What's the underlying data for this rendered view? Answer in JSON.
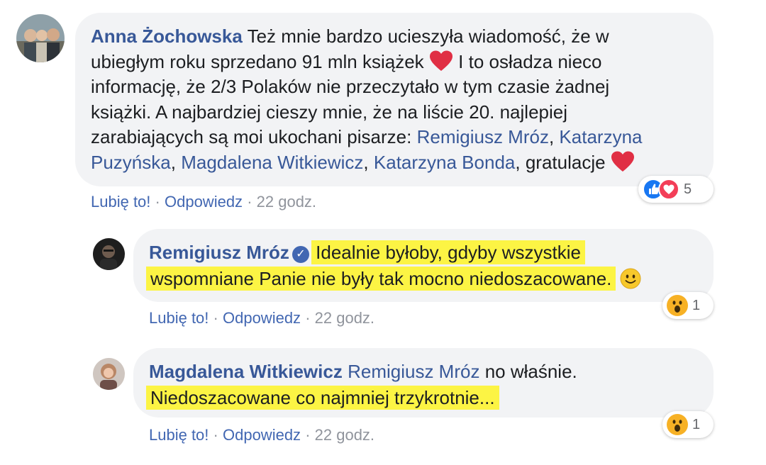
{
  "comment1": {
    "author": "Anna Żochowska",
    "text": {
      "l1": "Też mnie bardzo ucieszyła wiadomość, że w",
      "l2": "ubiegłym roku sprzedano 91 mln książek",
      "l2b": "I to osładza nieco",
      "l3": "informację, że 2/3 Polaków nie przeczytało w tym czasie żadnej",
      "l4": "książki. A najbardziej cieszy mnie, że na liście 20. najlepiej",
      "l5": "zarabiających są moi ukochani pisarze:",
      "mentions": [
        "Remigiusz Mróz",
        "Katarzyna",
        "Puzyńska",
        "Magdalena Witkiewicz",
        "Katarzyna Bonda"
      ],
      "sep": ",",
      "end": "gratulacje"
    },
    "reaction_count": "5",
    "reactions": [
      "like",
      "love"
    ]
  },
  "comment2": {
    "author": "Remigiusz Mróz",
    "verified_icon": "verified-badge-icon",
    "text": {
      "l1": "Idealnie byłoby, gdyby wszystkie",
      "l2": "wspomniane Panie nie były tak mocno niedoszacowane."
    },
    "reaction_count": "1",
    "reactions": [
      "wow"
    ]
  },
  "comment3": {
    "author": "Magdalena Witkiewicz",
    "mention": "Remigiusz Mróz",
    "text": {
      "l1": "no właśnie.",
      "l2": "Niedoszacowane co najmniej trzykrotnie..."
    },
    "reaction_count": "1",
    "reactions": [
      "wow"
    ]
  },
  "actions": {
    "like": "Lubię to!",
    "reply": "Odpowiedz",
    "dot": "·",
    "time": "22 godz."
  },
  "colors": {
    "link": "#385898",
    "action": "#4267b2",
    "bubble": "#f2f3f5",
    "highlight": "#fcf444",
    "heart": "#e02f44"
  }
}
